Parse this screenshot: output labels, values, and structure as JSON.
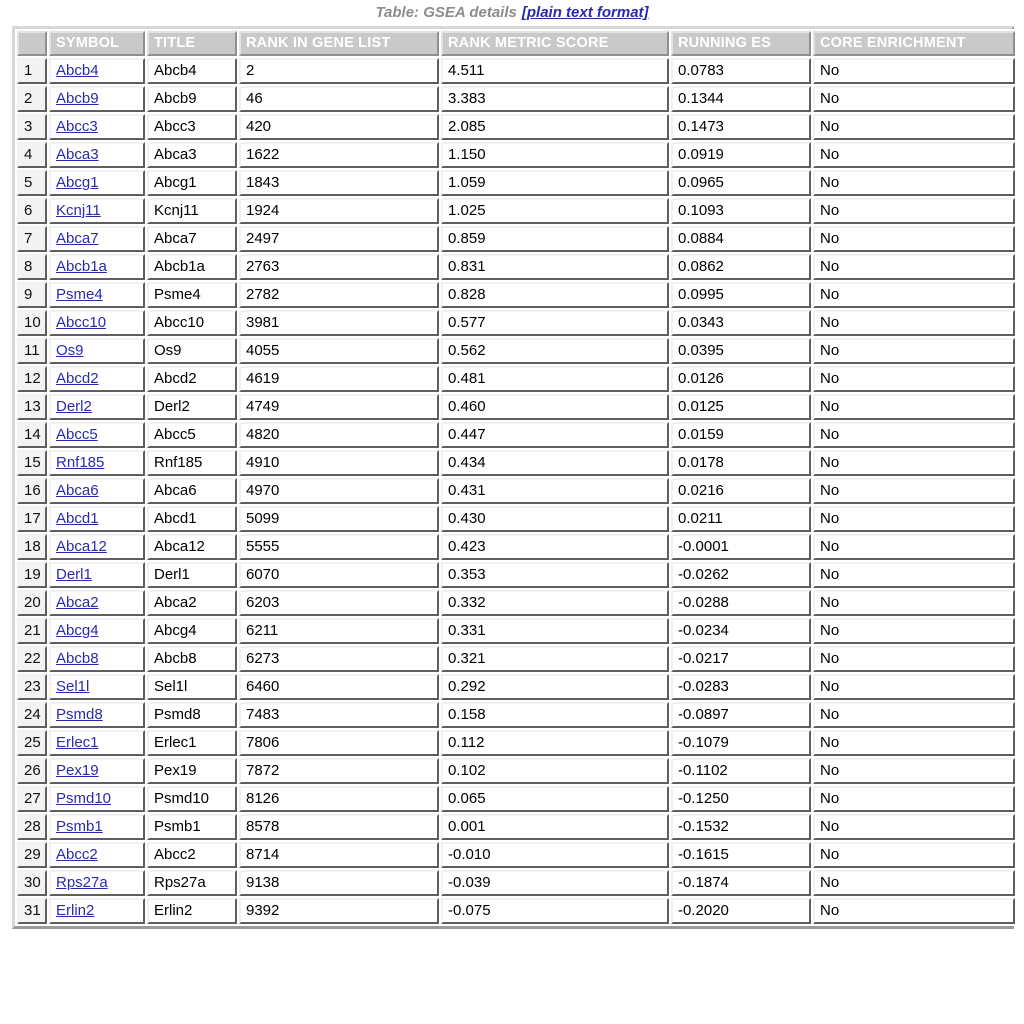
{
  "caption": {
    "text": "Table: GSEA details",
    "link_label": "[plain text format]"
  },
  "table": {
    "columns": [
      {
        "key": "idx",
        "label": ""
      },
      {
        "key": "sym",
        "label": "SYMBOL"
      },
      {
        "key": "tit",
        "label": "TITLE"
      },
      {
        "key": "rank",
        "label": "RANK IN GENE LIST"
      },
      {
        "key": "rms",
        "label": "RANK METRIC SCORE"
      },
      {
        "key": "res",
        "label": "RUNNING ES"
      },
      {
        "key": "core",
        "label": "CORE ENRICHMENT"
      }
    ],
    "rows": [
      {
        "idx": "1",
        "sym": "Abcb4",
        "tit": "Abcb4",
        "rank": "2",
        "rms": "4.511",
        "res": "0.0783",
        "core": "No"
      },
      {
        "idx": "2",
        "sym": "Abcb9",
        "tit": "Abcb9",
        "rank": "46",
        "rms": "3.383",
        "res": "0.1344",
        "core": "No"
      },
      {
        "idx": "3",
        "sym": "Abcc3",
        "tit": "Abcc3",
        "rank": "420",
        "rms": "2.085",
        "res": "0.1473",
        "core": "No"
      },
      {
        "idx": "4",
        "sym": "Abca3",
        "tit": "Abca3",
        "rank": "1622",
        "rms": "1.150",
        "res": "0.0919",
        "core": "No"
      },
      {
        "idx": "5",
        "sym": "Abcg1",
        "tit": "Abcg1",
        "rank": "1843",
        "rms": "1.059",
        "res": "0.0965",
        "core": "No"
      },
      {
        "idx": "6",
        "sym": "Kcnj11",
        "tit": "Kcnj11",
        "rank": "1924",
        "rms": "1.025",
        "res": "0.1093",
        "core": "No"
      },
      {
        "idx": "7",
        "sym": "Abca7",
        "tit": "Abca7",
        "rank": "2497",
        "rms": "0.859",
        "res": "0.0884",
        "core": "No"
      },
      {
        "idx": "8",
        "sym": "Abcb1a",
        "tit": "Abcb1a",
        "rank": "2763",
        "rms": "0.831",
        "res": "0.0862",
        "core": "No"
      },
      {
        "idx": "9",
        "sym": "Psme4",
        "tit": "Psme4",
        "rank": "2782",
        "rms": "0.828",
        "res": "0.0995",
        "core": "No"
      },
      {
        "idx": "10",
        "sym": "Abcc10",
        "tit": "Abcc10",
        "rank": "3981",
        "rms": "0.577",
        "res": "0.0343",
        "core": "No"
      },
      {
        "idx": "11",
        "sym": "Os9",
        "tit": "Os9",
        "rank": "4055",
        "rms": "0.562",
        "res": "0.0395",
        "core": "No"
      },
      {
        "idx": "12",
        "sym": "Abcd2",
        "tit": "Abcd2",
        "rank": "4619",
        "rms": "0.481",
        "res": "0.0126",
        "core": "No"
      },
      {
        "idx": "13",
        "sym": "Derl2",
        "tit": "Derl2",
        "rank": "4749",
        "rms": "0.460",
        "res": "0.0125",
        "core": "No"
      },
      {
        "idx": "14",
        "sym": "Abcc5",
        "tit": "Abcc5",
        "rank": "4820",
        "rms": "0.447",
        "res": "0.0159",
        "core": "No"
      },
      {
        "idx": "15",
        "sym": "Rnf185",
        "tit": "Rnf185",
        "rank": "4910",
        "rms": "0.434",
        "res": "0.0178",
        "core": "No"
      },
      {
        "idx": "16",
        "sym": "Abca6",
        "tit": "Abca6",
        "rank": "4970",
        "rms": "0.431",
        "res": "0.0216",
        "core": "No"
      },
      {
        "idx": "17",
        "sym": "Abcd1",
        "tit": "Abcd1",
        "rank": "5099",
        "rms": "0.430",
        "res": "0.0211",
        "core": "No"
      },
      {
        "idx": "18",
        "sym": "Abca12",
        "tit": "Abca12",
        "rank": "5555",
        "rms": "0.423",
        "res": "-0.0001",
        "core": "No"
      },
      {
        "idx": "19",
        "sym": "Derl1",
        "tit": "Derl1",
        "rank": "6070",
        "rms": "0.353",
        "res": "-0.0262",
        "core": "No"
      },
      {
        "idx": "20",
        "sym": "Abca2",
        "tit": "Abca2",
        "rank": "6203",
        "rms": "0.332",
        "res": "-0.0288",
        "core": "No"
      },
      {
        "idx": "21",
        "sym": "Abcg4",
        "tit": "Abcg4",
        "rank": "6211",
        "rms": "0.331",
        "res": "-0.0234",
        "core": "No"
      },
      {
        "idx": "22",
        "sym": "Abcb8",
        "tit": "Abcb8",
        "rank": "6273",
        "rms": "0.321",
        "res": "-0.0217",
        "core": "No"
      },
      {
        "idx": "23",
        "sym": "Sel1l",
        "tit": "Sel1l",
        "rank": "6460",
        "rms": "0.292",
        "res": "-0.0283",
        "core": "No"
      },
      {
        "idx": "24",
        "sym": "Psmd8",
        "tit": "Psmd8",
        "rank": "7483",
        "rms": "0.158",
        "res": "-0.0897",
        "core": "No"
      },
      {
        "idx": "25",
        "sym": "Erlec1",
        "tit": "Erlec1",
        "rank": "7806",
        "rms": "0.112",
        "res": "-0.1079",
        "core": "No"
      },
      {
        "idx": "26",
        "sym": "Pex19",
        "tit": "Pex19",
        "rank": "7872",
        "rms": "0.102",
        "res": "-0.1102",
        "core": "No"
      },
      {
        "idx": "27",
        "sym": "Psmd10",
        "tit": "Psmd10",
        "rank": "8126",
        "rms": "0.065",
        "res": "-0.1250",
        "core": "No"
      },
      {
        "idx": "28",
        "sym": "Psmb1",
        "tit": "Psmb1",
        "rank": "8578",
        "rms": "0.001",
        "res": "-0.1532",
        "core": "No"
      },
      {
        "idx": "29",
        "sym": "Abcc2",
        "tit": "Abcc2",
        "rank": "8714",
        "rms": "-0.010",
        "res": "-0.1615",
        "core": "No"
      },
      {
        "idx": "30",
        "sym": "Rps27a",
        "tit": "Rps27a",
        "rank": "9138",
        "rms": "-0.039",
        "res": "-0.1874",
        "core": "No"
      },
      {
        "idx": "31",
        "sym": "Erlin2",
        "tit": "Erlin2",
        "rank": "9392",
        "rms": "-0.075",
        "res": "-0.2020",
        "core": "No"
      }
    ]
  },
  "colors": {
    "link": "#2a2ab0",
    "header_bg": "#c9c9c9",
    "header_text": "#ffffff",
    "caption_text": "#8c8c8c",
    "index_cell_bg": "#f3f3f3"
  }
}
